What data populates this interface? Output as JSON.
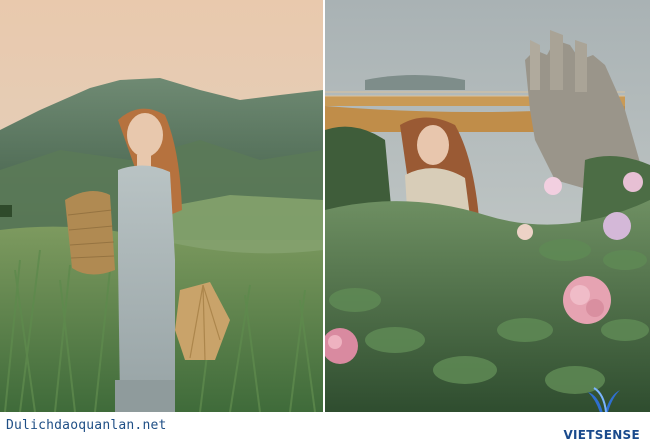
{
  "footer": {
    "website": "Dulichdaoquanlan.net",
    "brand": "VIETSENSE"
  },
  "photos": {
    "left": {
      "subject": "woman in green field with basket and conical hat"
    },
    "right": {
      "subject": "woman among hydrangeas with Golden Bridge hands"
    }
  },
  "colors": {
    "brand_blue": "#1a4a8c",
    "site_blue": "#1f4f86"
  },
  "icons": {
    "logo": "vietsense-wing-logo"
  }
}
